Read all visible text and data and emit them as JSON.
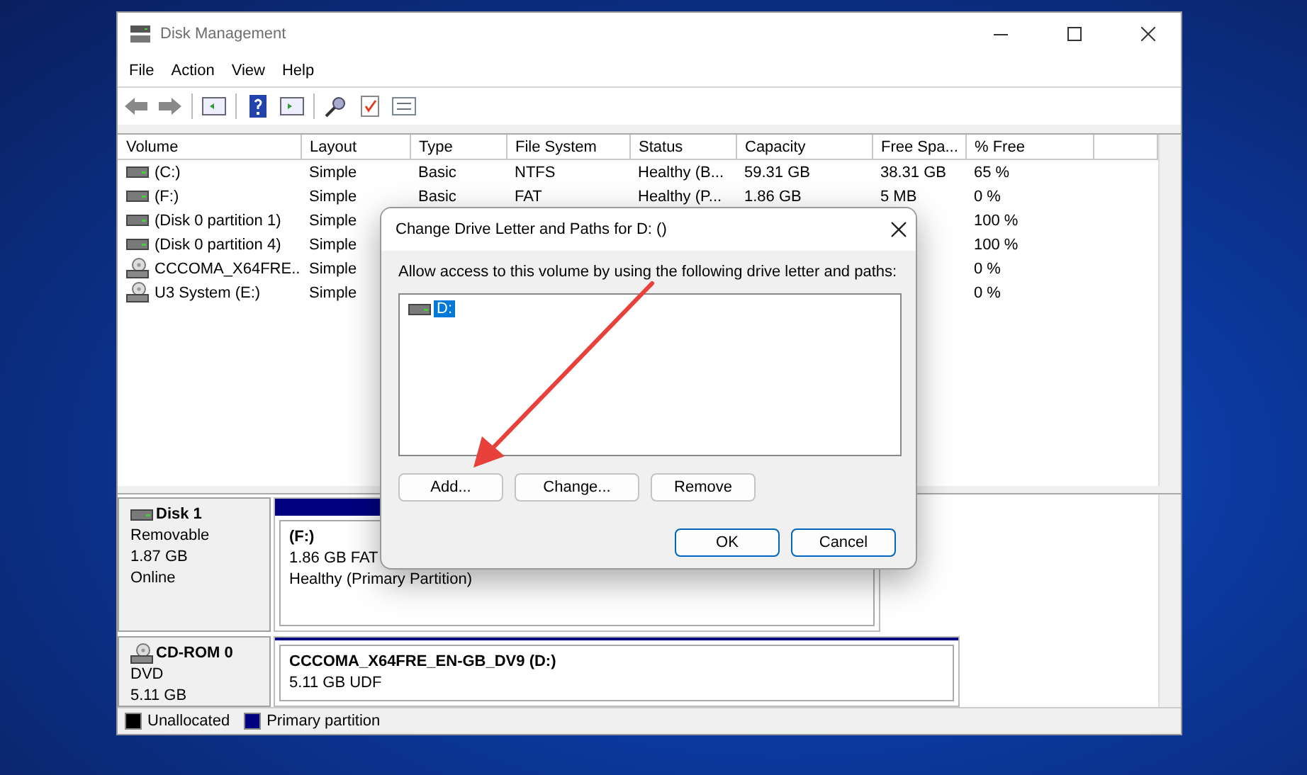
{
  "window": {
    "title": "Disk Management"
  },
  "menu": [
    "File",
    "Action",
    "View",
    "Help"
  ],
  "table": {
    "columns": [
      "Volume",
      "Layout",
      "Type",
      "File System",
      "Status",
      "Capacity",
      "Free Spa...",
      "% Free"
    ],
    "rows": [
      {
        "kind": "drive",
        "cells": [
          "(C:)",
          "Simple",
          "Basic",
          "NTFS",
          "Healthy (B...",
          "59.31 GB",
          "38.31 GB",
          "65 %"
        ]
      },
      {
        "kind": "drive",
        "cells": [
          "(F:)",
          "Simple",
          "Basic",
          "FAT",
          "Healthy (P...",
          "1.86 GB",
          "5 MB",
          "0 %"
        ]
      },
      {
        "kind": "drive",
        "cells": [
          "(Disk 0 partition 1)",
          "Simple",
          "",
          "",
          "",
          "",
          "",
          "100 %"
        ]
      },
      {
        "kind": "drive",
        "cells": [
          "(Disk 0 partition 4)",
          "Simple",
          "",
          "",
          "",
          "",
          "",
          "100 %"
        ]
      },
      {
        "kind": "disc",
        "cells": [
          "CCCOMA_X64FRE...",
          "Simple",
          "",
          "",
          "",
          "",
          "",
          "0 %"
        ]
      },
      {
        "kind": "disc",
        "cells": [
          "U3 System (E:)",
          "Simple",
          "",
          "",
          "",
          "",
          "",
          "0 %"
        ]
      }
    ]
  },
  "disks": [
    {
      "kind": "drive",
      "name": "Disk 1",
      "lines": [
        "Removable",
        "1.87 GB",
        "Online"
      ],
      "partition": {
        "label": "(F:)",
        "lines": [
          "1.86 GB FAT",
          "Healthy (Primary Partition)"
        ]
      }
    },
    {
      "kind": "disc",
      "name": "CD-ROM 0",
      "lines": [
        "DVD",
        "5.11 GB"
      ],
      "partition": {
        "label": "CCCOMA_X64FRE_EN-GB_DV9  (D:)",
        "lines": [
          "5.11 GB UDF"
        ]
      }
    }
  ],
  "legend": [
    {
      "label": "Unallocated",
      "color": "#000000"
    },
    {
      "label": "Primary partition",
      "color": "#000080"
    }
  ],
  "dialog": {
    "title": "Change Drive Letter and Paths for D: ()",
    "instruction": "Allow access to this volume by using the following drive letter and paths:",
    "paths": [
      {
        "label": "D:",
        "selected": true
      }
    ],
    "actions": [
      "Add...",
      "Change...",
      "Remove"
    ],
    "buttons": [
      "OK",
      "Cancel"
    ]
  }
}
